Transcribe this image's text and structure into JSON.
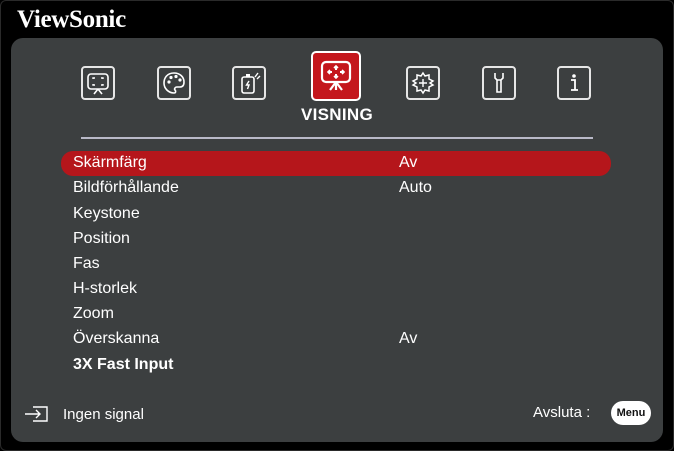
{
  "brand": "ViewSonic",
  "tabs": [
    {
      "icon": "picture-icon",
      "active": false
    },
    {
      "icon": "palette-icon",
      "active": false
    },
    {
      "icon": "power-icon",
      "active": false
    },
    {
      "icon": "display-icon",
      "active": true,
      "label": "VISNING"
    },
    {
      "icon": "gear-icon",
      "active": false
    },
    {
      "icon": "wrench-icon",
      "active": false
    },
    {
      "icon": "info-icon",
      "active": false
    }
  ],
  "active_tab_label": "VISNING",
  "menu": [
    {
      "label": "Skärmfärg",
      "value": "Av",
      "selected": true
    },
    {
      "label": "Bildförhållande",
      "value": "Auto"
    },
    {
      "label": "Keystone",
      "value": ""
    },
    {
      "label": "Position",
      "value": ""
    },
    {
      "label": "Fas",
      "value": ""
    },
    {
      "label": "H-storlek",
      "value": ""
    },
    {
      "label": "Zoom",
      "value": ""
    },
    {
      "label": "Överskanna",
      "value": "Av"
    },
    {
      "label": "3X Fast Input",
      "value": "",
      "bold": true
    }
  ],
  "footer": {
    "signal_text": "Ingen signal",
    "exit_text": "Avsluta :",
    "menu_button": "Menu"
  },
  "colors": {
    "accent": "#c4171d",
    "panel": "#3c3f40",
    "background": "#000000"
  }
}
